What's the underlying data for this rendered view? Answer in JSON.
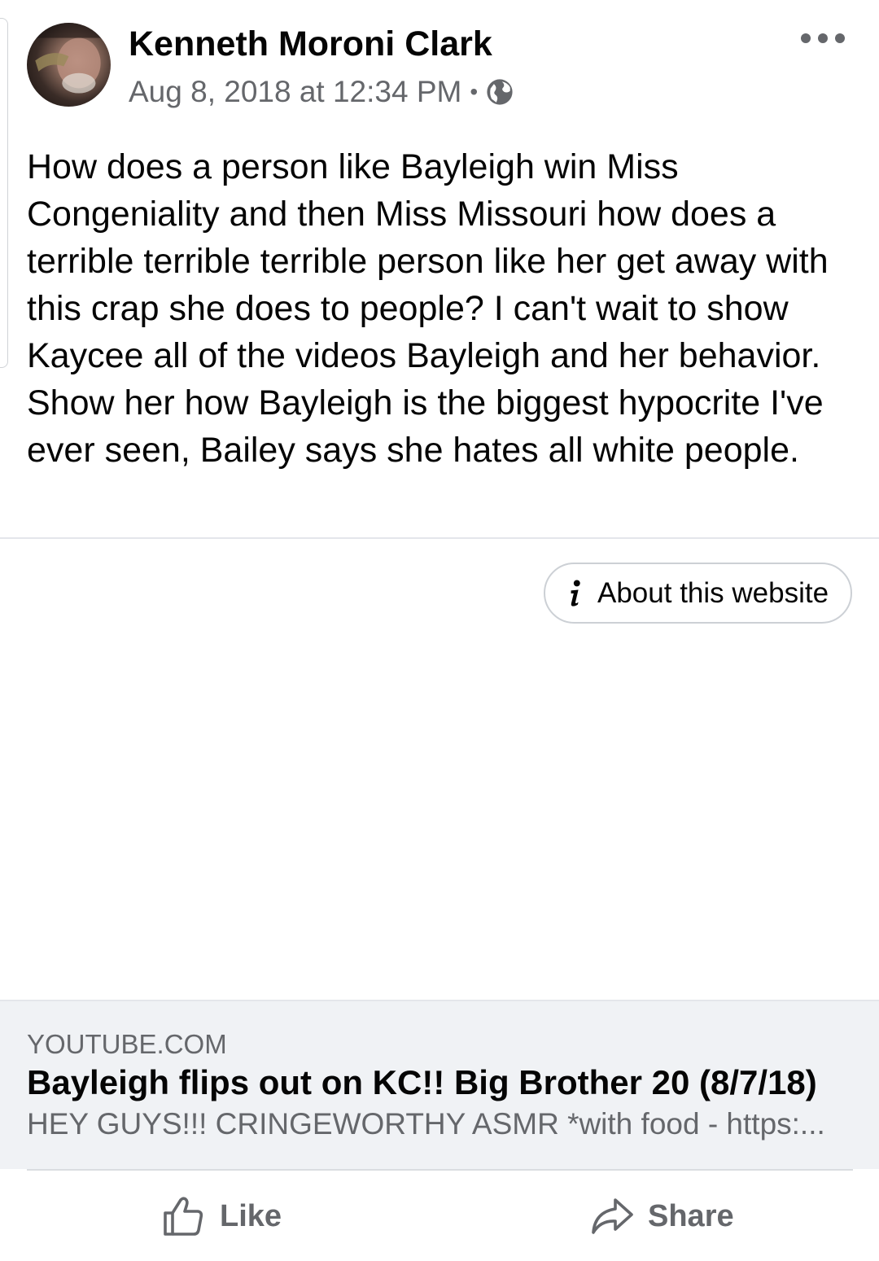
{
  "post": {
    "author": "Kenneth Moroni Clark",
    "timestamp": "Aug 8, 2018 at 12:34 PM",
    "separator": "•",
    "privacy_icon": "globe-icon",
    "more_icon": "more-options-icon",
    "text": "How does a person like Bayleigh win Miss Congeniality and then Miss Missouri how does a terrible terrible terrible person like her get away with this crap she does to people? I can't wait to show Kaycee all of the videos Bayleigh and her behavior. Show her how Bayleigh is the biggest hypocrite I've ever seen, Bailey says she hates all white people."
  },
  "about_website": {
    "icon": "info-icon",
    "label": "About this website"
  },
  "link_preview": {
    "domain": "YOUTUBE.COM",
    "title": "Bayleigh flips out on KC!! Big Brother 20 (8/7/18)",
    "description": "HEY GUYS!!! CRINGEWORTHY ASMR *with food - https:..."
  },
  "actions": {
    "like_label": "Like",
    "like_icon": "thumbs-up-icon",
    "share_label": "Share",
    "share_icon": "share-arrow-icon"
  },
  "colors": {
    "primary_text": "#050505",
    "secondary_text": "#65676b",
    "preview_background": "#f0f2f5",
    "divider": "#e4e6eb"
  }
}
